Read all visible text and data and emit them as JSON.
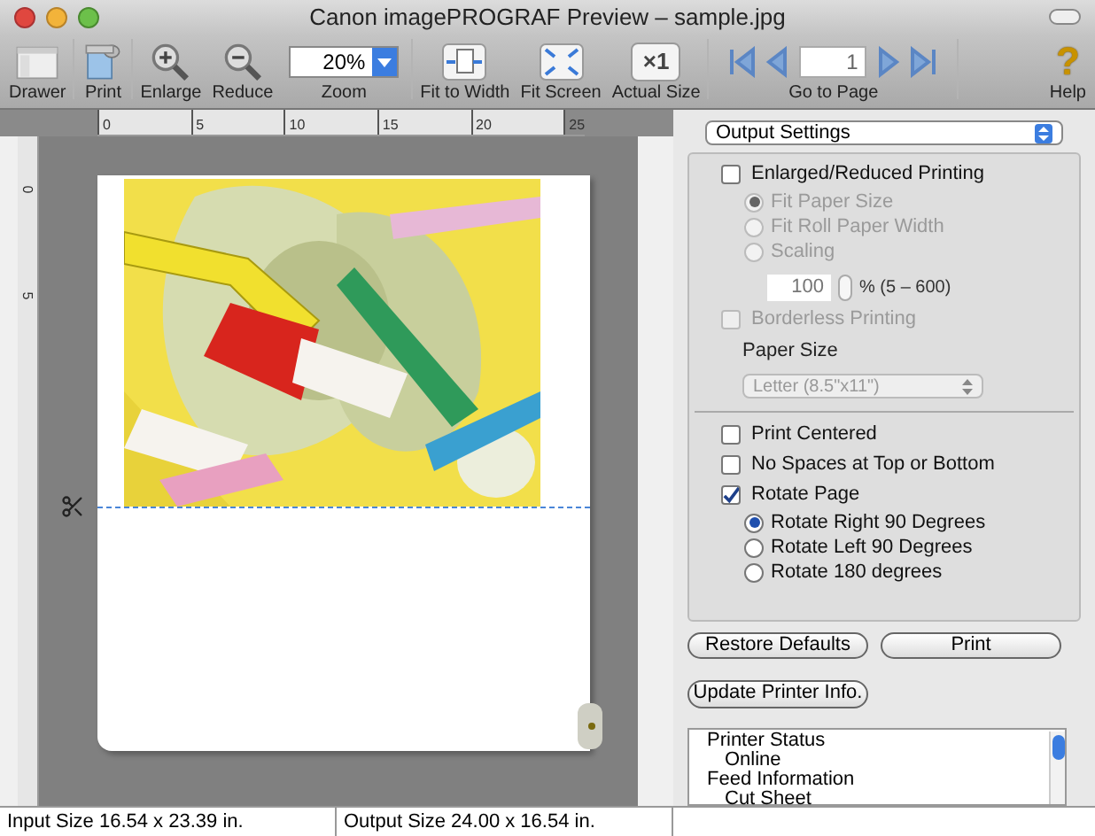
{
  "window": {
    "title": "Canon imagePROGRAF Preview – sample.jpg"
  },
  "toolbar": [
    {
      "kind": "drawer",
      "label": "Drawer"
    },
    {
      "kind": "print",
      "label": "Print"
    },
    {
      "kind": "enlarge",
      "label": "Enlarge"
    },
    {
      "kind": "reduce",
      "label": "Reduce"
    },
    {
      "kind": "zoom",
      "label": "Zoom",
      "value": "20%"
    },
    {
      "kind": "fit-width",
      "label": "Fit to Width"
    },
    {
      "kind": "fit-screen",
      "label": "Fit Screen"
    },
    {
      "kind": "actual",
      "label": "Actual Size",
      "glyph": "×1"
    },
    {
      "kind": "pager",
      "label": "Go to Page",
      "value": "1"
    },
    {
      "kind": "help",
      "label": "Help",
      "glyph": "?"
    }
  ],
  "ruler": {
    "horizontal": [
      "0",
      "5",
      "10",
      "15",
      "20",
      "25"
    ],
    "vertical": [
      "0",
      "5"
    ]
  },
  "preview": {
    "kind": "picture"
  },
  "panel": {
    "select": "Output Settings",
    "options": [
      {
        "kind": "checkbox",
        "label": "Enlarged/Reduced Printing",
        "checked": false,
        "disabled": false
      },
      {
        "kind": "radio",
        "label": "Fit Paper Size",
        "selected": true,
        "disabled": true
      },
      {
        "kind": "radio",
        "label": "Fit Roll Paper Width",
        "selected": false,
        "disabled": true
      },
      {
        "kind": "radio",
        "label": "Scaling",
        "selected": false,
        "disabled": true
      },
      {
        "kind": "spinner",
        "value": "100",
        "suffix": "% (5 – 600)",
        "disabled": true
      },
      {
        "kind": "checkbox",
        "label": "Borderless Printing",
        "checked": false,
        "disabled": true
      },
      {
        "kind": "heading",
        "label": "Paper Size"
      },
      {
        "kind": "select",
        "label": "Letter (8.5\"x11\")",
        "disabled": true
      },
      {
        "kind": "divider"
      },
      {
        "kind": "checkbox",
        "label": "Print Centered",
        "checked": false,
        "disabled": false
      },
      {
        "kind": "checkbox",
        "label": "No Spaces at Top or Bottom",
        "checked": false,
        "disabled": false
      },
      {
        "kind": "checkbox",
        "label": "Rotate Page",
        "checked": true,
        "disabled": false
      },
      {
        "kind": "radio",
        "label": "Rotate Right 90 Degrees",
        "selected": true,
        "disabled": false
      },
      {
        "kind": "radio",
        "label": "Rotate Left 90 Degrees",
        "selected": false,
        "disabled": false
      },
      {
        "kind": "radio",
        "label": "Rotate 180 degrees",
        "selected": false,
        "disabled": false
      }
    ],
    "buttons": [
      "Restore Defaults",
      "Print",
      "Update Printer Info."
    ],
    "info": [
      {
        "label": "Printer Status",
        "children": [
          {
            "label": "Online"
          }
        ]
      },
      {
        "label": "Feed Information",
        "children": [
          {
            "label": "Cut Sheet"
          }
        ]
      }
    ]
  },
  "status_bar": [
    "Input Size 16.54 x 23.39 in.",
    "Output Size 24.00 x 16.54 in."
  ]
}
